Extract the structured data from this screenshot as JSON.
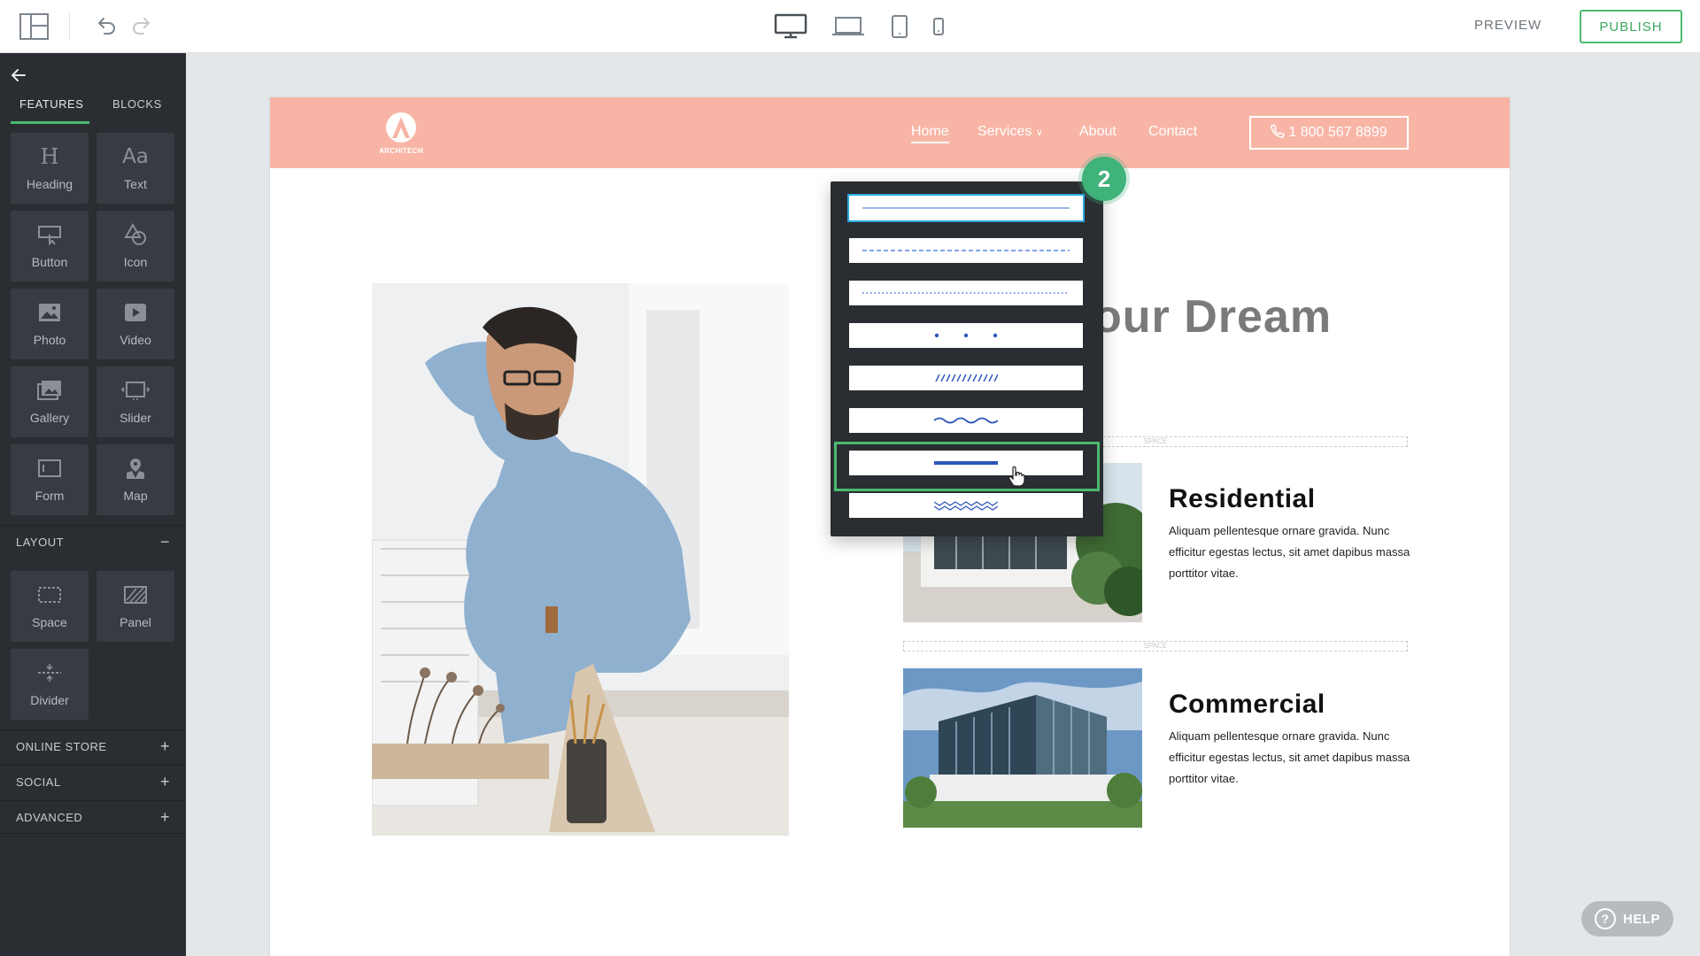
{
  "toolbar": {
    "preview_label": "PREVIEW",
    "publish_label": "PUBLISH",
    "devices": [
      "desktop-icon",
      "laptop-icon",
      "tablet-icon",
      "mobile-icon"
    ]
  },
  "sidebar": {
    "tabs": [
      {
        "label": "FEATURES",
        "active": true
      },
      {
        "label": "BLOCKS",
        "active": false
      }
    ],
    "feature_tiles": [
      {
        "label": "Heading",
        "icon": "heading-icon",
        "glyph": "H"
      },
      {
        "label": "Text",
        "icon": "text-icon",
        "glyph": "Aa"
      },
      {
        "label": "Button",
        "icon": "button-icon"
      },
      {
        "label": "Icon",
        "icon": "shapes-icon"
      },
      {
        "label": "Photo",
        "icon": "photo-icon"
      },
      {
        "label": "Video",
        "icon": "video-icon"
      },
      {
        "label": "Gallery",
        "icon": "gallery-icon"
      },
      {
        "label": "Slider",
        "icon": "slider-icon"
      },
      {
        "label": "Form",
        "icon": "form-icon"
      },
      {
        "label": "Map",
        "icon": "map-icon"
      }
    ],
    "layout_section": {
      "label": "LAYOUT",
      "sign": "−"
    },
    "layout_tiles": [
      {
        "label": "Space",
        "icon": "space-icon"
      },
      {
        "label": "Panel",
        "icon": "panel-icon"
      },
      {
        "label": "Divider",
        "icon": "divider-icon"
      }
    ],
    "collapsed_sections": [
      {
        "label": "ONLINE STORE",
        "sign": "+"
      },
      {
        "label": "SOCIAL",
        "sign": "+"
      },
      {
        "label": "ADVANCED",
        "sign": "+"
      }
    ]
  },
  "site": {
    "header_color": "#f8b5a6",
    "logo_text": "ARCHITECH",
    "nav": [
      {
        "label": "Home",
        "active": true
      },
      {
        "label": "Services",
        "has_dropdown": true
      },
      {
        "label": "About"
      },
      {
        "label": "Contact"
      }
    ],
    "phone": "1 800 567 8899",
    "hero_title_fragment": "our Dream",
    "space_label": "SPACE",
    "cards": [
      {
        "title": "Residential",
        "text": "Aliquam pellentesque ornare gravida. Nunc efficitur egestas lectus, sit amet dapibus massa porttitor vitae."
      },
      {
        "title": "Commercial",
        "text": "Aliquam pellentesque ornare gravida. Nunc efficitur egestas lectus, sit amet dapibus massa porttitor vitae."
      }
    ]
  },
  "divider_picker": {
    "step_number": "2",
    "options": [
      "thin-solid",
      "dashed",
      "dotted",
      "spaced-dots",
      "slashes",
      "wave",
      "thick-short",
      "zigzag"
    ],
    "selected": "thin-solid",
    "hovered": "thick-short"
  },
  "help": {
    "label": "HELP"
  },
  "colors": {
    "accent_green": "#4cb96f",
    "sidebar_bg": "#2a2e33",
    "selection_blue": "#29a8e0"
  }
}
